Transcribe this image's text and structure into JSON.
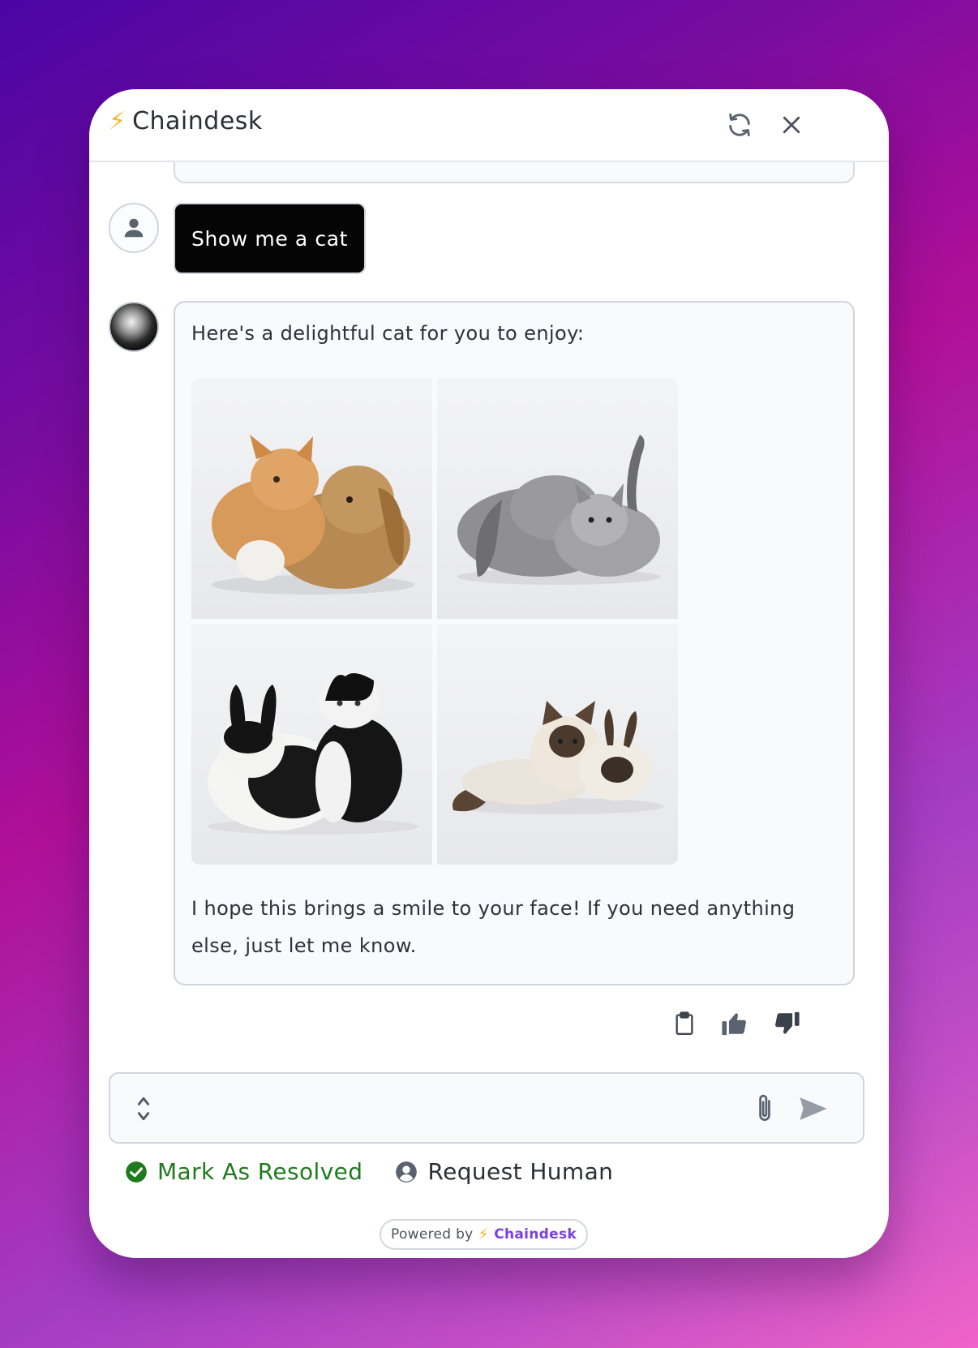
{
  "header": {
    "bolt_glyph": "⚡",
    "title": "Chaindesk",
    "refresh_icon": "refresh-icon",
    "close_icon": "close-icon"
  },
  "messages": {
    "user": {
      "text": "Show me a cat"
    },
    "bot": {
      "intro": "Here's a delightful cat for you to enjoy:",
      "images": [
        "kitten-and-rabbit-1",
        "kitten-and-rabbit-2",
        "kitten-and-rabbit-3",
        "kitten-and-rabbit-4"
      ],
      "outro": "I hope this brings a smile to your face! If you need anything else, just let me know."
    },
    "actions": [
      "copy-icon",
      "thumbs-up-icon",
      "thumbs-down-icon"
    ]
  },
  "composer": {
    "value": "",
    "placeholder": ""
  },
  "footer": {
    "resolve_label": "Mark As Resolved",
    "human_label": "Request Human",
    "powered_prefix": "Powered by",
    "powered_bolt": "⚡",
    "powered_brand": "Chaindesk"
  },
  "colors": {
    "resolved": "#1f7a1f",
    "brand_purple": "#7b3fe4",
    "bolt": "#f5b82e"
  }
}
